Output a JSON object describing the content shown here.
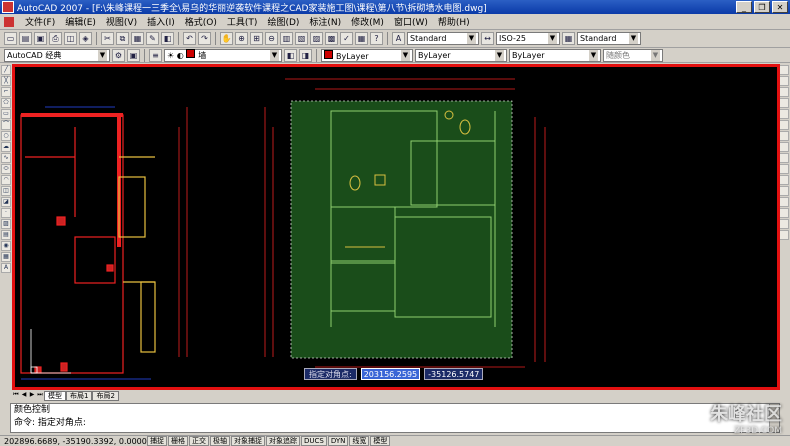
{
  "window": {
    "title": "AutoCAD 2007 - [F:\\朱峰课程一三季全\\易乌的华丽逆袭软件课程之CAD家装施工图\\课程\\第八节\\拆砌墙水电图.dwg]",
    "watermark": "优酷"
  },
  "menu": [
    "文件(F)",
    "编辑(E)",
    "视图(V)",
    "插入(I)",
    "格式(O)",
    "工具(T)",
    "绘图(D)",
    "标注(N)",
    "修改(M)",
    "窗口(W)",
    "帮助(H)"
  ],
  "toolbar": {
    "text_style": "Standard",
    "dim_style": "ISO-25",
    "table_style": "Standard",
    "workspace": "AutoCAD 经典",
    "layer": "墙",
    "color": "ByLayer",
    "linetype": "ByLayer",
    "lineweight": "ByLayer",
    "plot_style": "随颜色",
    "colors": {
      "layer_swatch": "#cc0000"
    }
  },
  "dynamic_input": {
    "prompt": "指定对角点:",
    "x_value": "203156.2595",
    "y_value": "-35126.5747"
  },
  "tabs": [
    "模型",
    "布局1",
    "布局2"
  ],
  "command": {
    "history": "颜色控制",
    "prompt": "命令: 指定对角点:"
  },
  "status": {
    "coords": "202896.6689, -35190.3392, 0.0000",
    "buttons": [
      "捕捉",
      "栅格",
      "正交",
      "极轴",
      "对象捕捉",
      "对象追踪",
      "DUCS",
      "DYN",
      "线宽",
      "模型"
    ]
  },
  "brand": {
    "name": "朱峰社区",
    "url": "ZF3D.COM"
  }
}
